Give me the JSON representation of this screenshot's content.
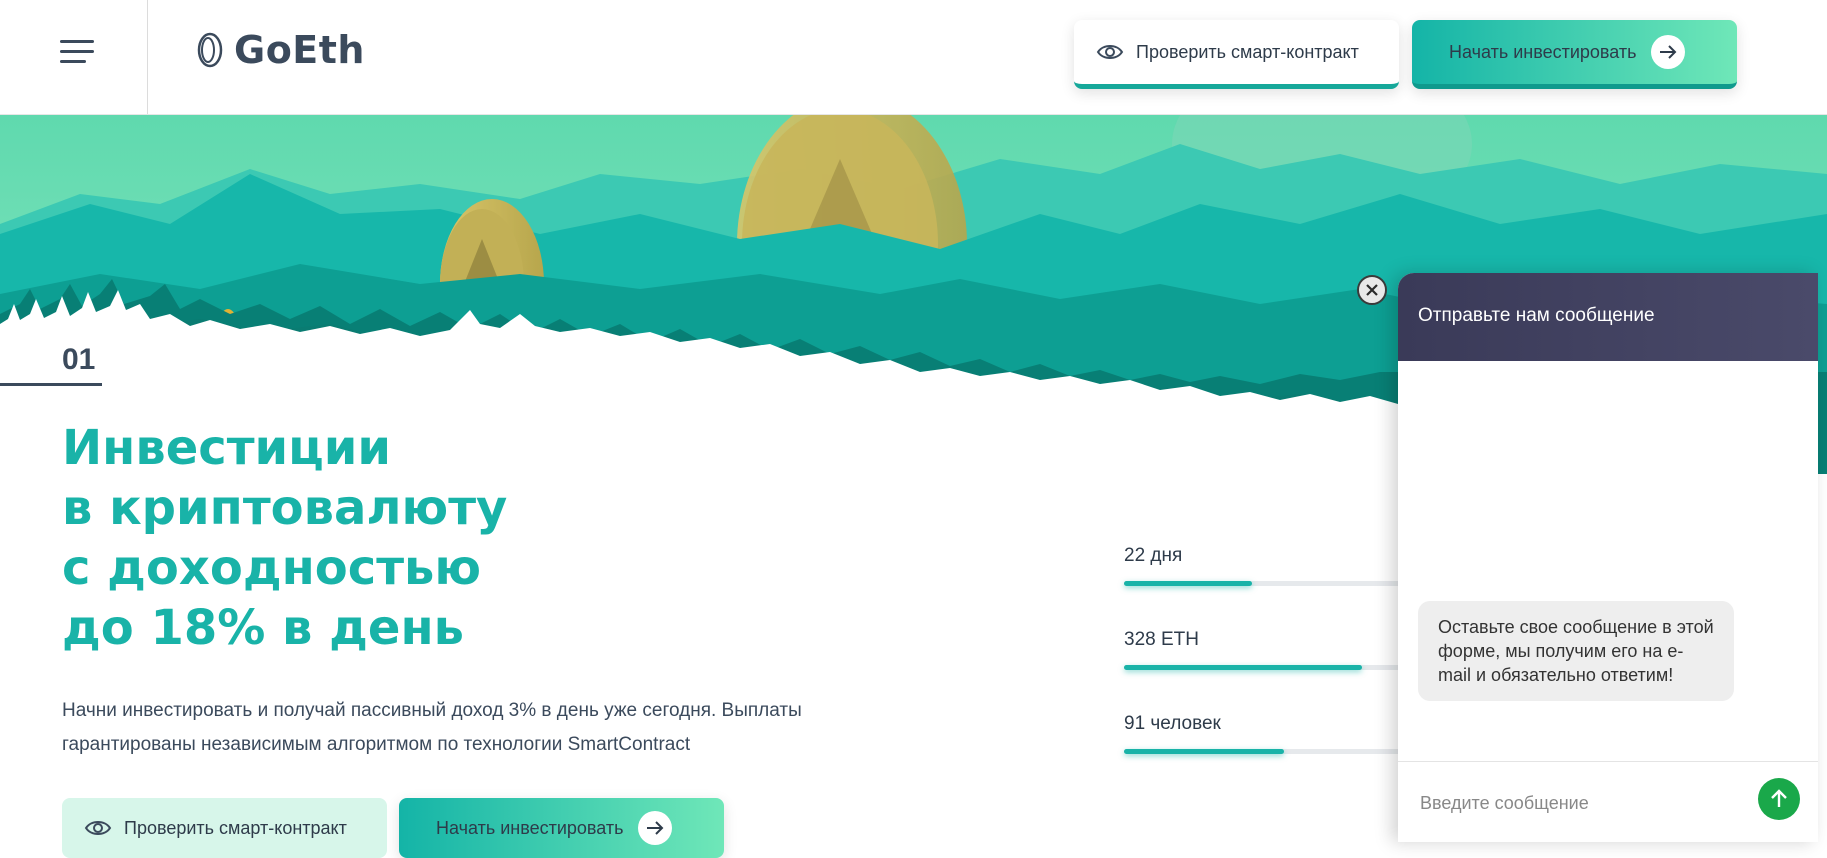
{
  "header": {
    "brand": "GoEth",
    "check_contract_label": "Проверить смарт-контракт",
    "start_invest_label": "Начать инвестировать"
  },
  "hero": {
    "slide_number": "01",
    "title_lines": [
      "Инвестиции",
      "в криптовалюту",
      "с доходностью",
      "до 18% в день"
    ],
    "description": "Начни инвестировать и получай пассивный доход 3% в день уже сегодня. Выплаты гарантированы независимым алгоритмом по технологии SmartContract",
    "check_contract_label": "Проверить смарт-контракт",
    "start_invest_label": "Начать инвестировать"
  },
  "stats": [
    {
      "label": "22 дня",
      "progress": 0.44
    },
    {
      "label": "328 ETH",
      "progress": 0.82
    },
    {
      "label": "91 человек",
      "progress": 0.55
    }
  ],
  "chat": {
    "title": "Отправьте нам сообщение",
    "bubble": "Оставьте свое сообщение в этой форме, мы получим его на e-mail и обязательно ответим!",
    "input_placeholder": "Введите сообщение"
  },
  "colors": {
    "accent": "#19b3a8",
    "dark": "#3b4a5c",
    "chat_header": "#3a3a58",
    "send": "#1aa84a"
  },
  "icons": [
    "menu-icon",
    "coin-logo-icon",
    "eye-icon",
    "arrow-right-icon",
    "close-icon",
    "send-arrow-icon"
  ]
}
